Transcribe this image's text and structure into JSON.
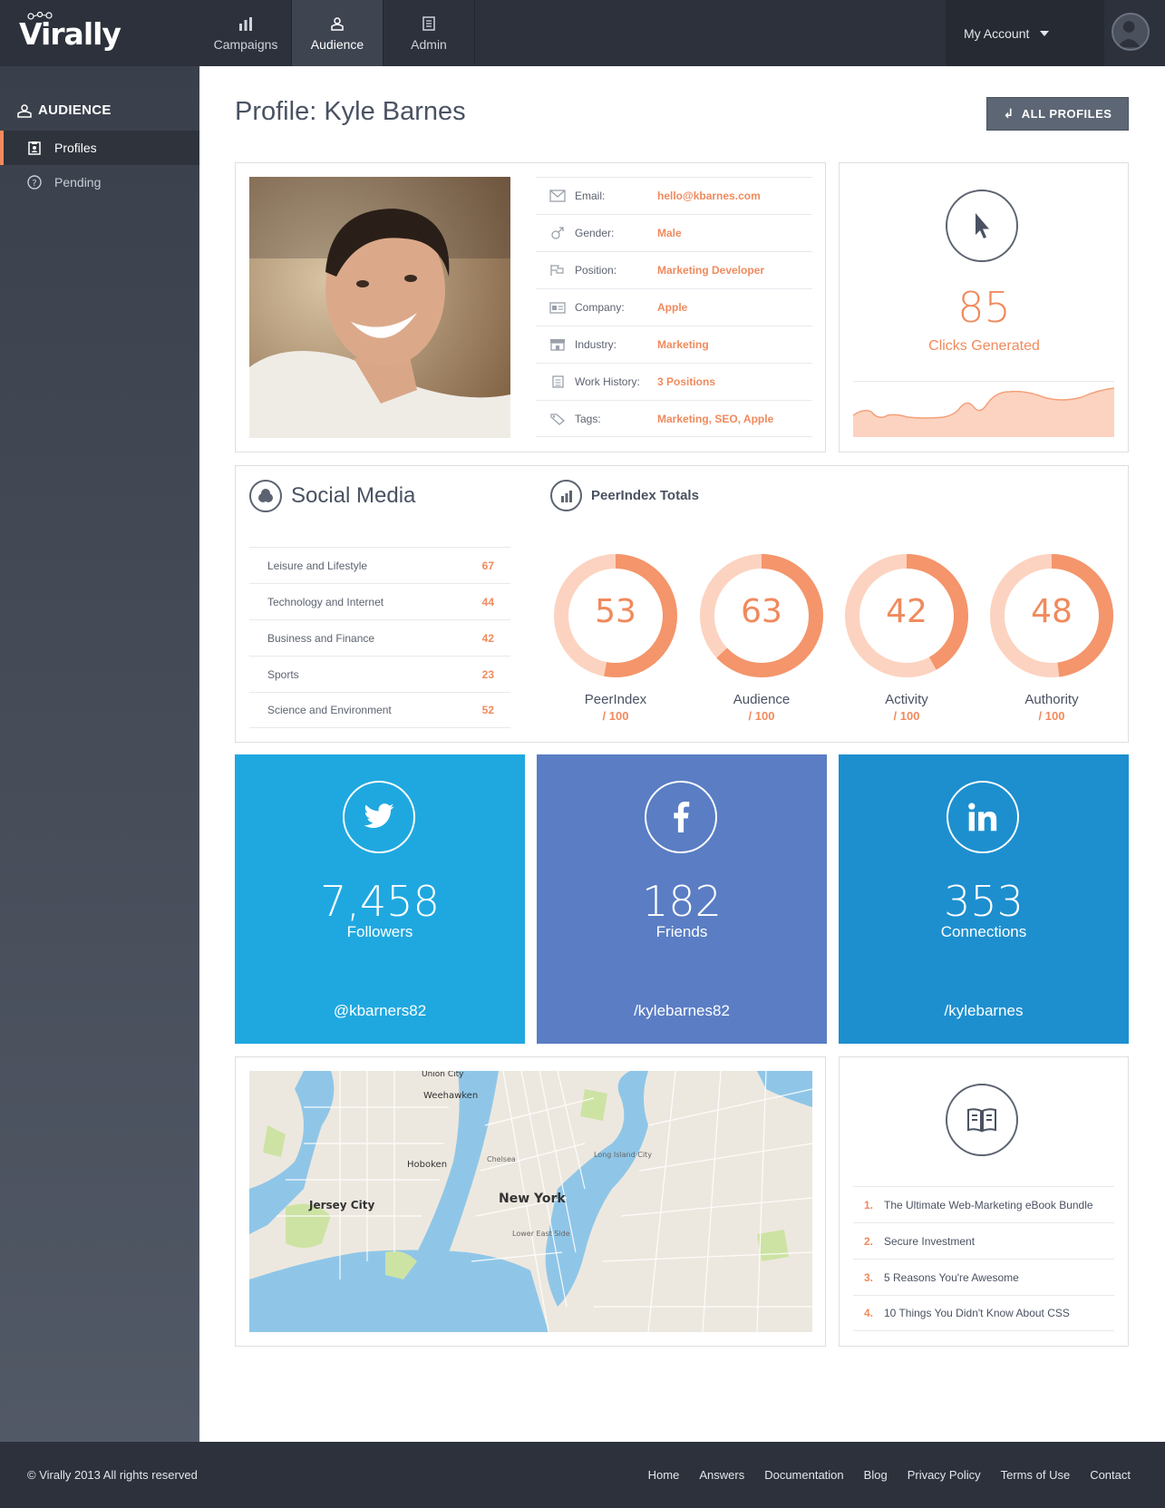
{
  "app": {
    "logo": "Virally"
  },
  "nav": {
    "items": [
      {
        "label": "Campaigns"
      },
      {
        "label": "Audience"
      },
      {
        "label": "Admin"
      }
    ],
    "account": "My Account"
  },
  "sidebar": {
    "title": "AUDIENCE",
    "items": [
      {
        "label": "Profiles"
      },
      {
        "label": "Pending"
      }
    ]
  },
  "page": {
    "title": "Profile: Kyle Barnes",
    "all_profiles": "ALL PROFILES"
  },
  "profile": {
    "rows": [
      {
        "label": "Email:",
        "value": "hello@kbarnes.com"
      },
      {
        "label": "Gender:",
        "value": "Male"
      },
      {
        "label": "Position:",
        "value": "Marketing Developer"
      },
      {
        "label": "Company:",
        "value": "Apple"
      },
      {
        "label": "Industry:",
        "value": "Marketing"
      },
      {
        "label": "Work History:",
        "value": "3 Positions"
      },
      {
        "label": "Tags:",
        "value": "Marketing, SEO, Apple"
      }
    ]
  },
  "clicks": {
    "value": "85",
    "label": "Clicks Generated"
  },
  "social_media": {
    "title": "Social Media",
    "rows": [
      {
        "label": "Leisure and Lifestyle",
        "value": "67"
      },
      {
        "label": "Technology and Internet",
        "value": "44"
      },
      {
        "label": "Business and Finance",
        "value": "42"
      },
      {
        "label": "Sports",
        "value": "23"
      },
      {
        "label": "Science and Environment",
        "value": "52"
      }
    ]
  },
  "peerindex": {
    "title": "PeerIndex Totals",
    "max_label": "/ 100",
    "items": [
      {
        "name": "PeerIndex",
        "value": 53
      },
      {
        "name": "Audience",
        "value": 63
      },
      {
        "name": "Activity",
        "value": 42
      },
      {
        "name": "Authority",
        "value": 48
      }
    ]
  },
  "tiles": [
    {
      "count": "7,458",
      "label": "Followers",
      "handle": "@kbarners82",
      "color": "#1fa8e0"
    },
    {
      "count": "182",
      "label": "Friends",
      "handle": "/kylebarnes82",
      "color": "#5a7dc4"
    },
    {
      "count": "353",
      "label": "Connections",
      "handle": "/kylebarnes",
      "color": "#1d8fcf"
    }
  ],
  "map": {
    "labels": [
      "Union City",
      "Weehawken",
      "Hoboken",
      "Jersey City",
      "New York",
      "Chelsea",
      "Long Island City",
      "Lower East Side"
    ]
  },
  "reading": {
    "items": [
      {
        "num": "1.",
        "title": "The Ultimate Web-Marketing eBook Bundle"
      },
      {
        "num": "2.",
        "title": "Secure Investment"
      },
      {
        "num": "3.",
        "title": "5 Reasons You're Awesome"
      },
      {
        "num": "4.",
        "title": "10 Things You Didn't Know About CSS"
      }
    ]
  },
  "footer": {
    "copyright": "© Virally 2013 All rights reserved",
    "links": [
      "Home",
      "Answers",
      "Documentation",
      "Blog",
      "Privacy Policy",
      "Terms of Use",
      "Contact"
    ]
  },
  "colors": {
    "accent": "#f08a5d",
    "accent_light": "#fcd3c0",
    "dark": "#2c313b"
  }
}
